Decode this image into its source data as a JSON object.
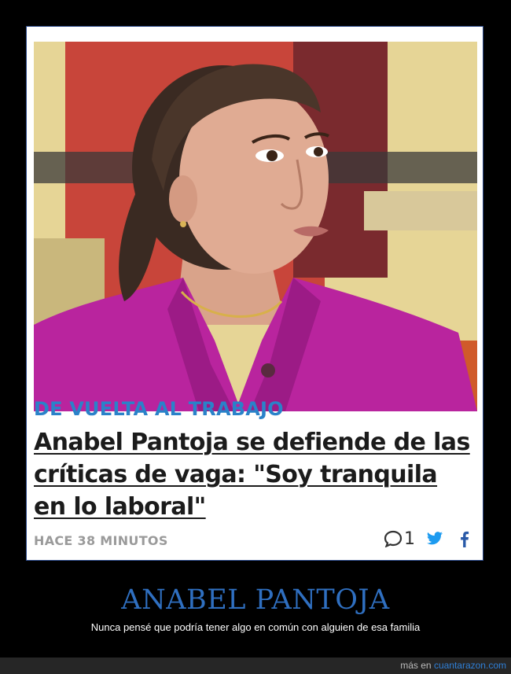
{
  "article": {
    "kicker": "DE VUELTA AL TRABAJO",
    "headline": "Anabel Pantoja se defiende de las críticas de vaga: \"Soy tranquila en lo laboral\"",
    "time": "HACE 38 MINUTOS",
    "comment_count": "1",
    "icons": [
      "comment-icon",
      "twitter-icon",
      "facebook-icon"
    ]
  },
  "caption": {
    "title": "ANABEL PANTOJA",
    "subtitle": "Nunca pensé que podría tener algo en común con alguien de esa familia"
  },
  "footer": {
    "prefix": "más en",
    "site": "cuantarazon.com"
  },
  "colors": {
    "kicker": "#2a82c9",
    "caption_title": "#2f6fc0",
    "twitter": "#1d9bf0",
    "facebook": "#2a5aa8",
    "jacket": "#b9249e"
  }
}
